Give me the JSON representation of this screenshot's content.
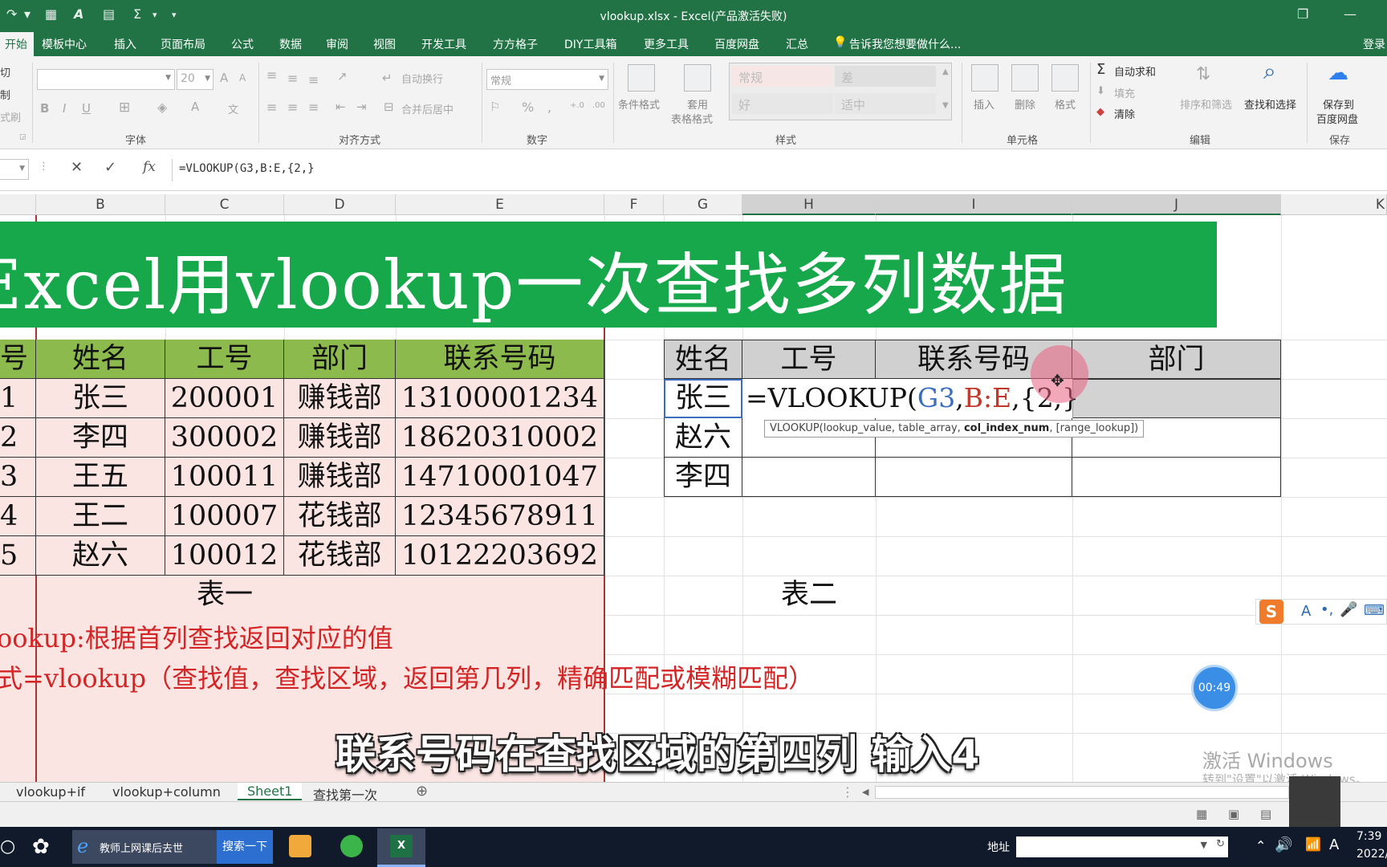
{
  "window": {
    "title": "vlookup.xlsx - Excel(产品激活失败)",
    "minimize_symbol": "—",
    "restore_symbol": "❐"
  },
  "quick_access": {
    "sum_symbol": "Σ"
  },
  "ribbon_tabs": [
    "开始",
    "模板中心",
    "插入",
    "页面布局",
    "公式",
    "数据",
    "审阅",
    "视图",
    "开发工具",
    "方方格子",
    "DIY工具箱",
    "更多工具",
    "百度网盘",
    "汇总"
  ],
  "tell_me": "告诉我您想要做什么...",
  "login": "登录",
  "ribbon": {
    "clipboard": {
      "cut": "切",
      "copy": "制",
      "format_painter": "式刷"
    },
    "font": {
      "name": "",
      "size": "20",
      "bold": "B",
      "italic": "I",
      "underline": "U",
      "grow": "A",
      "shrink": "A",
      "font_color": "A",
      "phonetic": "文",
      "label": "字体"
    },
    "alignment": {
      "wrap": "自动换行",
      "merge": "合并后居中",
      "label": "对齐方式"
    },
    "number": {
      "format": "常规",
      "percent": "%",
      "comma": ",",
      "inc_decimal": "+.0",
      "dec_decimal": ".00",
      "label": "数字"
    },
    "styles": {
      "conditional": "条件格式",
      "table_format_1": "套用",
      "table_format_2": "表格格式",
      "normal": "常规",
      "bad": "差",
      "good": "好",
      "neutral": "适中",
      "label": "样式"
    },
    "cells": {
      "insert": "插入",
      "delete": "删除",
      "format": "格式",
      "label": "单元格"
    },
    "editing": {
      "autosum": "自动求和",
      "fill": "填充",
      "clear": "清除",
      "sort_filter": "排序和筛选",
      "find_select": "查找和选择",
      "label": "编辑"
    },
    "save": {
      "line1": "保存到",
      "line2": "百度网盘",
      "label": "保存"
    }
  },
  "formula_bar": {
    "cancel": "✕",
    "enter": "✓",
    "fx": "fx",
    "formula": "=VLOOKUP(G3,B:E,{2,}"
  },
  "columns": [
    "B",
    "C",
    "D",
    "E",
    "F",
    "G",
    "H",
    "I",
    "J",
    "K"
  ],
  "banner": "Excel用vlookup一次查找多列数据",
  "table1": {
    "header_first": "号",
    "headers": [
      "姓名",
      "工号",
      "部门",
      "联系号码"
    ],
    "row_nums": [
      "1",
      "2",
      "3",
      "4",
      "5"
    ],
    "rows": [
      [
        "张三",
        "200001",
        "赚钱部",
        "13100001234"
      ],
      [
        "李四",
        "300002",
        "赚钱部",
        "18620310002"
      ],
      [
        "王五",
        "100011",
        "赚钱部",
        "14710001047"
      ],
      [
        "王二",
        "100007",
        "花钱部",
        "12345678911"
      ],
      [
        "赵六",
        "100012",
        "花钱部",
        "10122203692"
      ]
    ],
    "caption": "表一"
  },
  "table2": {
    "headers": [
      "姓名",
      "工号",
      "联系号码",
      "部门"
    ],
    "names": [
      "张三",
      "赵六",
      "李四"
    ],
    "caption": "表二",
    "edit_formula": {
      "part1": "=VLOOKUP(",
      "ref1": "G3",
      "comma1": ",",
      "ref2": "B:E",
      "rest": ",{2,}"
    },
    "tooltip": {
      "fn": "VLOOKUP(lookup_value, table_array, ",
      "active": "col_index_num",
      "tail": ", [range_lookup])"
    }
  },
  "notes": {
    "line1": "ookup:根据首列查找返回对应的值",
    "line2": "式=vlookup（查找值，查找区域，返回第几列，精确匹配或模糊匹配）"
  },
  "sheet_tabs": [
    "vlookup+if",
    "vlookup+column",
    "Sheet1",
    "查找第一次"
  ],
  "active_sheet": "Sheet1",
  "add_sheet": "⊕",
  "timer": "00:49",
  "watermark": {
    "line1": "激活 Windows",
    "line2": "转到\"设置\"以激活 Windows。"
  },
  "subtitle": "联系号码在查找区域的第四列 输入4",
  "ime": {
    "logo": "S",
    "a": "A"
  },
  "taskbar": {
    "ie_task": "教师上网课后去世",
    "search_btn": "搜索一下",
    "address_label": "地址",
    "time": "7:39",
    "date": "2022/",
    "ime_a": "A"
  },
  "colors": {
    "excel_green": "#217346",
    "banner_green": "#16a84a",
    "header_green": "#8dba4c",
    "pink": "#fbe5e3",
    "red_text": "#d32525",
    "ref_blue": "#3b6dbf",
    "ref_red": "#c0392b"
  }
}
